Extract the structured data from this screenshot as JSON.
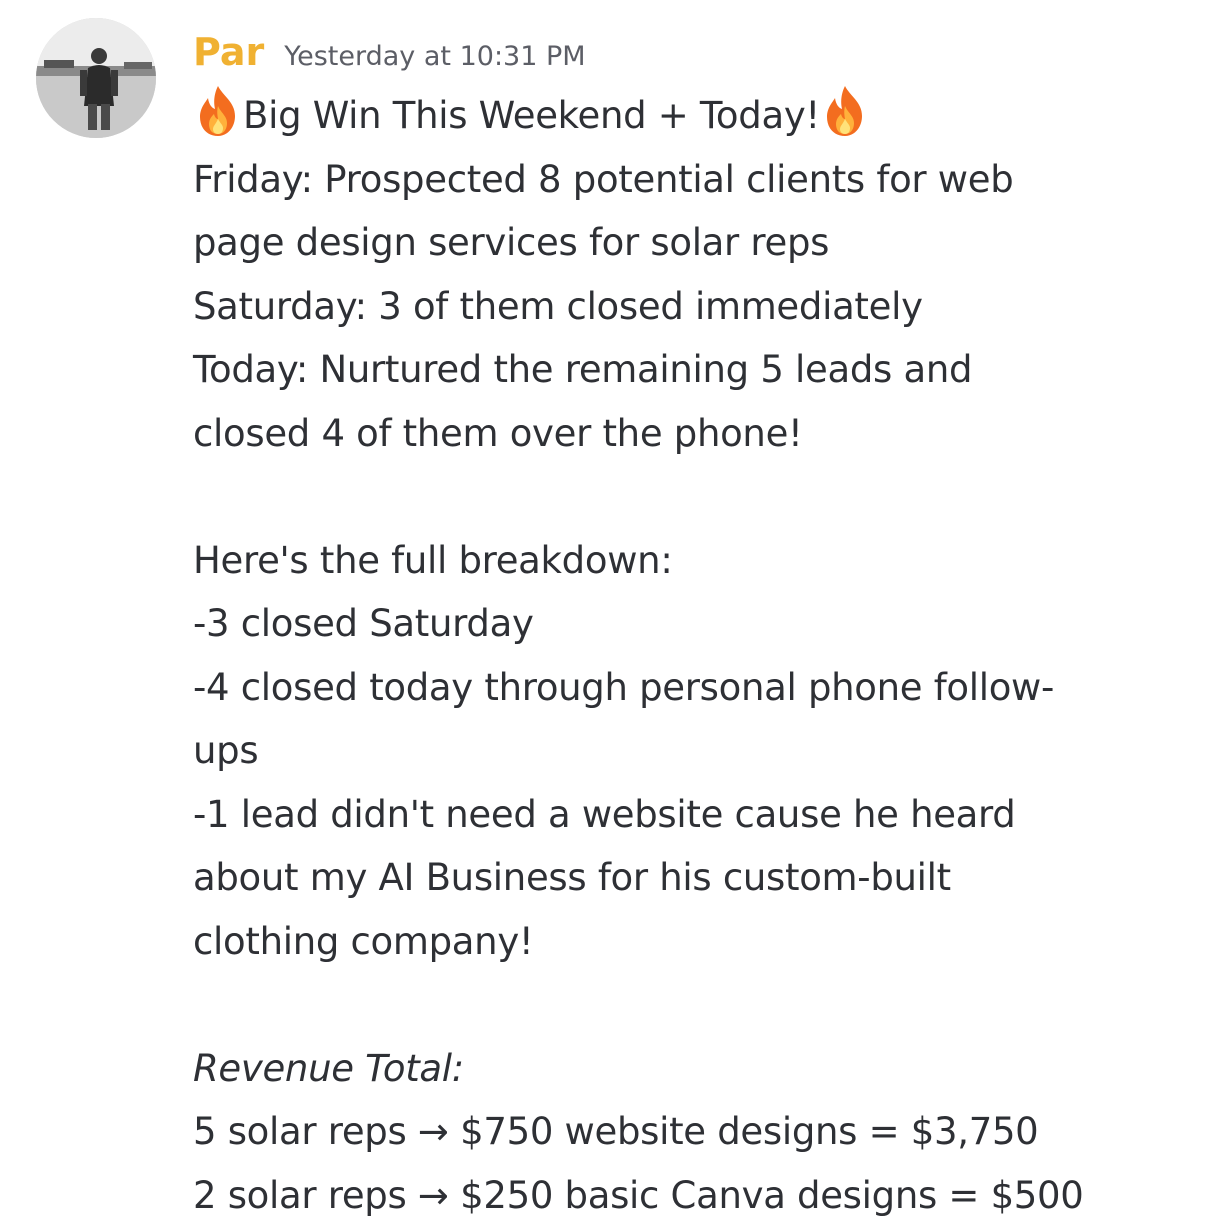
{
  "message": {
    "author": "Par",
    "timestamp": "Yesterday at 10:31 PM",
    "author_color": "#f0b132",
    "avatar_icon": "user-avatar-photo",
    "title": {
      "emoji": "fire-emoji",
      "text": "Big Win This Weekend + Today!"
    },
    "lines": [
      "Friday: Prospected 8 potential clients for web",
      "page design services for solar reps",
      "Saturday: 3 of them closed immediately",
      "Today: Nurtured the remaining 5 leads and",
      "closed 4 of them over the phone!"
    ],
    "breakdown_heading": "Here's the full breakdown:",
    "breakdown": [
      "-3 closed Saturday",
      "-4 closed today through personal phone follow-",
      "ups",
      "-1 lead didn't need a website cause he heard",
      "about my AI Business for his custom-built",
      "clothing company!"
    ],
    "revenue_heading": "Revenue Total:",
    "revenue": [
      "5 solar reps → $750 website designs = $3,750",
      "2 solar reps → $250 basic Canva designs = $500"
    ]
  }
}
